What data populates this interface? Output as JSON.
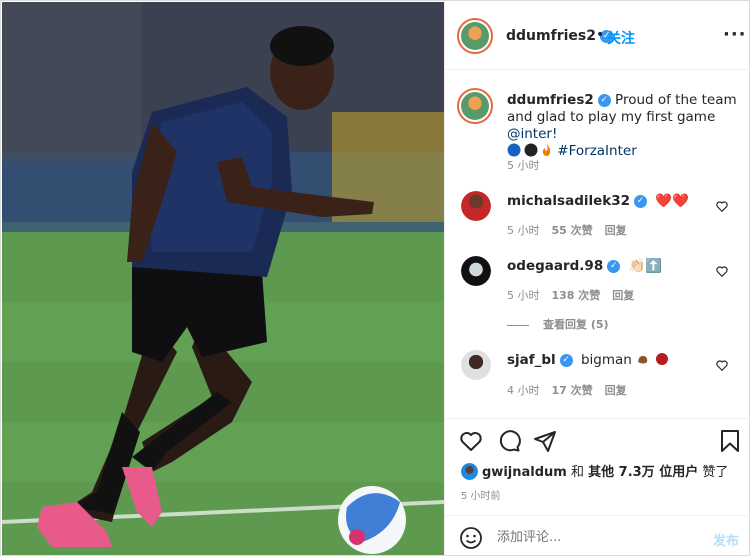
{
  "header": {
    "username": "ddumfries2",
    "separator": "•",
    "follow_label": "关注",
    "more_label": "···"
  },
  "caption": {
    "username": "ddumfries2",
    "text_part1": "Proud of the team and glad to play my first game",
    "mention": "@inter!",
    "hashtag": "#ForzaInter",
    "time": "5 小时"
  },
  "comments": [
    {
      "username": "michalsadilek32",
      "text": "❤️❤️",
      "time": "5 小时",
      "likes": "55 次赞",
      "reply": "回复"
    },
    {
      "username": "odegaard.98",
      "text": "👏🏻⬆️",
      "time": "5 小时",
      "likes": "138 次赞",
      "reply": "回复"
    },
    {
      "username": "sjaf_bl",
      "text": "bigman",
      "time": "4 小时",
      "likes": "17 次赞",
      "reply": "回复"
    }
  ],
  "view_replies": "查看回复 (5)",
  "likes_line": {
    "user": "gwijnaldum",
    "and": "和",
    "others": "其他 7.3万 位用户",
    "suffix": "赞了"
  },
  "post_time": "5 小时前",
  "add_comment": {
    "placeholder": "添加评论...",
    "post_label": "发布"
  },
  "colors": {
    "verified": "#3897f0",
    "link": "#00376b",
    "follow": "#0095f6",
    "heart": "#ed4956",
    "jersey": "#1a2a55"
  },
  "icons": [
    "heart-icon",
    "comment-icon",
    "share-icon",
    "bookmark-icon",
    "emoji-icon",
    "verified-icon"
  ]
}
